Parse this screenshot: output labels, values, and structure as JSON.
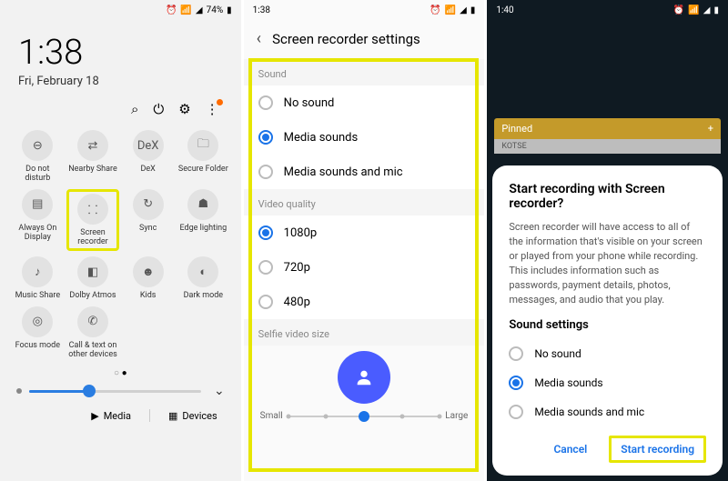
{
  "panel1": {
    "status": {
      "time": "",
      "battery": "74%",
      "icons": [
        "⏰",
        "📶",
        "◢"
      ]
    },
    "clock": {
      "time": "1:38",
      "date": "Fri, February 18"
    },
    "topicons": {
      "search": "⌕",
      "power": "⏻",
      "settings": "⚙",
      "more": "⋮"
    },
    "tiles": [
      {
        "icon": "⊖",
        "label": "Do not disturb"
      },
      {
        "icon": "⇄",
        "label": "Nearby Share"
      },
      {
        "icon": "DeX",
        "label": "DeX"
      },
      {
        "icon": "🗀",
        "label": "Secure Folder"
      },
      {
        "icon": "▤",
        "label": "Always On Display"
      },
      {
        "icon": "⸬",
        "label": "Screen recorder",
        "highlight": true
      },
      {
        "icon": "↻",
        "label": "Sync"
      },
      {
        "icon": "☗",
        "label": "Edge lighting"
      },
      {
        "icon": "♪",
        "label": "Music Share"
      },
      {
        "icon": "◧",
        "label": "Dolby Atmos"
      },
      {
        "icon": "☻",
        "label": "Kids"
      },
      {
        "icon": "◐",
        "label": "Dark mode"
      },
      {
        "icon": "◎",
        "label": "Focus mode"
      },
      {
        "icon": "✆",
        "label": "Call & text on other devices"
      }
    ],
    "footer": {
      "media": "Media",
      "devices": "Devices"
    }
  },
  "panel2": {
    "status": {
      "time": "1:38",
      "icons": [
        "⏰",
        "📶",
        "◢",
        "▮"
      ]
    },
    "title": "Screen recorder settings",
    "sections": {
      "sound": {
        "label": "Sound",
        "options": [
          {
            "label": "No sound",
            "selected": false
          },
          {
            "label": "Media sounds",
            "selected": true
          },
          {
            "label": "Media sounds and mic",
            "selected": false
          }
        ]
      },
      "video": {
        "label": "Video quality",
        "options": [
          {
            "label": "1080p",
            "selected": true
          },
          {
            "label": "720p",
            "selected": false
          },
          {
            "label": "480p",
            "selected": false
          }
        ]
      },
      "selfie": {
        "label": "Selfie video size",
        "small": "Small",
        "large": "Large"
      }
    }
  },
  "panel3": {
    "status": {
      "time": "1:40",
      "icons": [
        "⏰",
        "📶",
        "◢",
        "▮"
      ]
    },
    "pinned": {
      "label": "Pinned",
      "plus": "+",
      "sub": "KOTSE"
    },
    "dialog": {
      "title": "Start recording with Screen recorder?",
      "body": "Screen recorder will have access to all of the information that's visible on your screen or played from your phone while recording. This includes information such as passwords, payment details, photos, messages, and audio that you play.",
      "subhead": "Sound settings",
      "options": [
        {
          "label": "No sound",
          "selected": false
        },
        {
          "label": "Media sounds",
          "selected": true
        },
        {
          "label": "Media sounds and mic",
          "selected": false
        }
      ],
      "cancel": "Cancel",
      "start": "Start recording"
    }
  }
}
